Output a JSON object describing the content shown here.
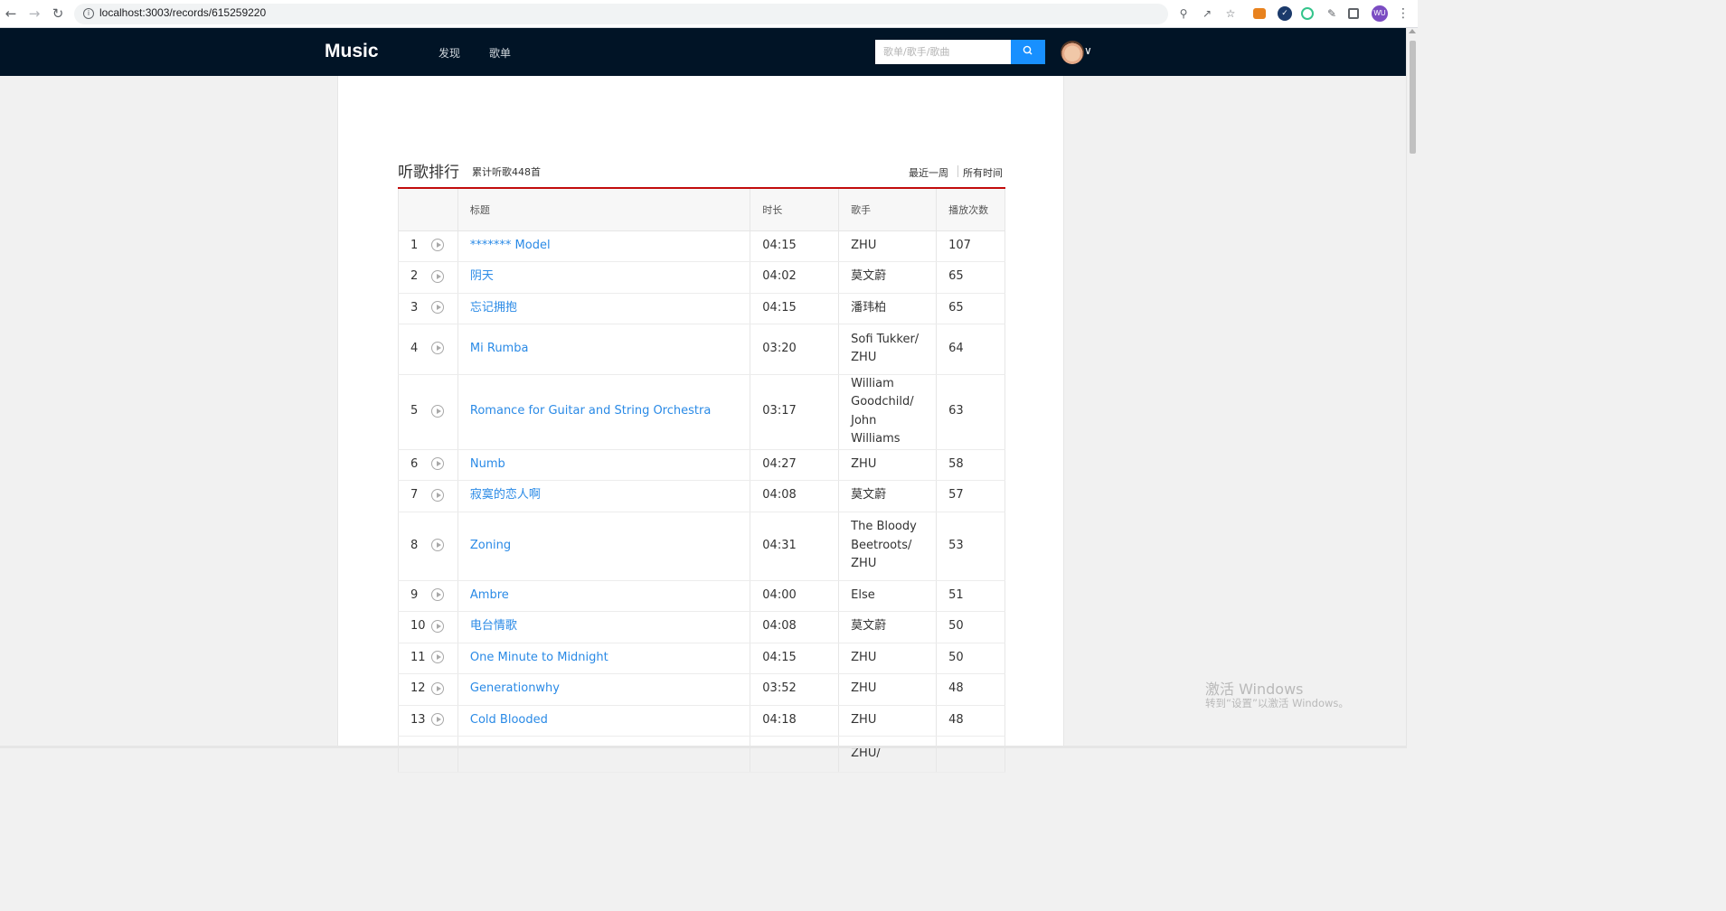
{
  "browser": {
    "url": "localhost:3003/records/615259220",
    "profile_initials": "WU"
  },
  "header": {
    "logo": "Music",
    "nav": [
      "发现",
      "歌单"
    ],
    "search_placeholder": "歌单/歌手/歌曲"
  },
  "ranking": {
    "title": "听歌排行",
    "total": "累计听歌448首",
    "range_week": "最近一周",
    "range_all": "所有时间",
    "columns": {
      "title": "标题",
      "duration": "时长",
      "artist": "歌手",
      "plays": "播放次数"
    },
    "rows": [
      {
        "index": "1",
        "title": "******* Model",
        "duration": "04:15",
        "artist": "ZHU",
        "plays": "107"
      },
      {
        "index": "2",
        "title": "阴天",
        "duration": "04:02",
        "artist": "莫文蔚",
        "plays": "65"
      },
      {
        "index": "3",
        "title": "忘记拥抱",
        "duration": "04:15",
        "artist": "潘玮柏",
        "plays": "65"
      },
      {
        "index": "4",
        "title": "Mi Rumba",
        "duration": "03:20",
        "artist": "Sofi Tukker/ ZHU",
        "plays": "64"
      },
      {
        "index": "5",
        "title": "Romance for Guitar and String Orchestra",
        "duration": "03:17",
        "artist": "William Goodchild/ John Williams",
        "plays": "63"
      },
      {
        "index": "6",
        "title": "Numb",
        "duration": "04:27",
        "artist": "ZHU",
        "plays": "58"
      },
      {
        "index": "7",
        "title": "寂寞的恋人啊",
        "duration": "04:08",
        "artist": "莫文蔚",
        "plays": "57"
      },
      {
        "index": "8",
        "title": "Zoning",
        "duration": "04:31",
        "artist": "The Bloody Beetroots/ ZHU",
        "plays": "53"
      },
      {
        "index": "9",
        "title": "Ambre",
        "duration": "04:00",
        "artist": "Else",
        "plays": "51"
      },
      {
        "index": "10",
        "title": "电台情歌",
        "duration": "04:08",
        "artist": "莫文蔚",
        "plays": "50"
      },
      {
        "index": "11",
        "title": "One Minute to Midnight",
        "duration": "04:15",
        "artist": "ZHU",
        "plays": "50"
      },
      {
        "index": "12",
        "title": "Generationwhy",
        "duration": "03:52",
        "artist": "ZHU",
        "plays": "48"
      },
      {
        "index": "13",
        "title": "Cold Blooded",
        "duration": "04:18",
        "artist": "ZHU",
        "plays": "48"
      },
      {
        "index": "",
        "title": "",
        "duration": "",
        "artist": "ZHU/",
        "plays": ""
      }
    ]
  },
  "watermark": {
    "line1": "激活 Windows",
    "line2": "转到“设置”以激活 Windows。"
  },
  "colors": {
    "header_bg": "#011426",
    "accent_red": "#c20c0c",
    "link_blue": "#2a8ae6",
    "search_blue": "#1890ff"
  }
}
